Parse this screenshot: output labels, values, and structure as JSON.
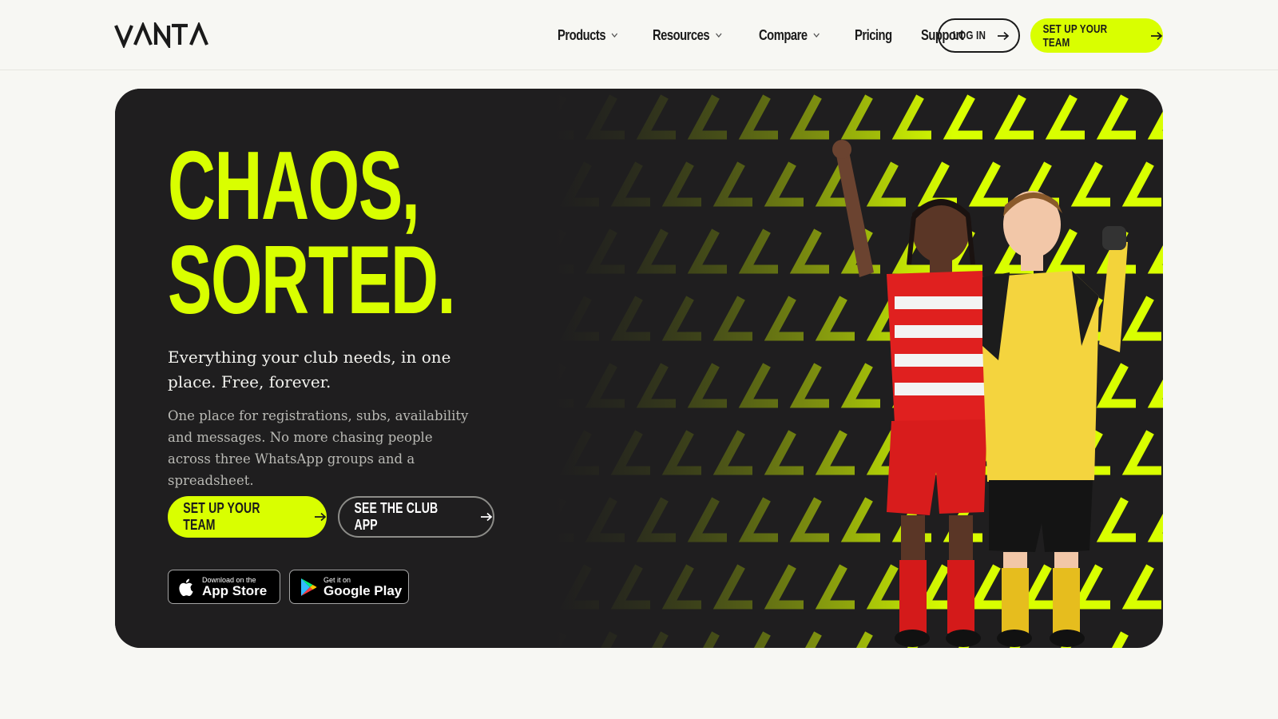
{
  "header": {
    "logo_text": "VANTA",
    "nav": [
      {
        "label": "Products",
        "has_dropdown": true
      },
      {
        "label": "Resources",
        "has_dropdown": true
      },
      {
        "label": "Compare",
        "has_dropdown": true
      },
      {
        "label": "Pricing",
        "has_dropdown": false
      },
      {
        "label": "Support",
        "has_dropdown": false
      }
    ],
    "login_label": "LOG IN",
    "cta_label": "SET UP YOUR TEAM"
  },
  "hero": {
    "headline_line1": "CHAOS,",
    "headline_line2": "SORTED.",
    "lead": "Everything your club needs, in one place. Free, forever.",
    "sub": "One place for registrations, subs, availability and messages. No more chasing people across three WhatsApp groups and a spreadsheet.",
    "primary_cta": "SET UP YOUR TEAM",
    "secondary_cta": "SEE THE CLUB APP",
    "app_store": {
      "small": "Download on the",
      "big": "App Store"
    },
    "google_play": {
      "small": "Get it on",
      "big": "Google Play"
    }
  },
  "colors": {
    "accent": "#d9ff00",
    "hero_bg": "#1f1e1f",
    "page_bg": "#f7f7f3",
    "text": "#1a1a1a"
  },
  "icons": [
    "vanta-logo",
    "chevron-down-icon",
    "arrow-right-icon",
    "apple-icon",
    "google-play-icon"
  ]
}
